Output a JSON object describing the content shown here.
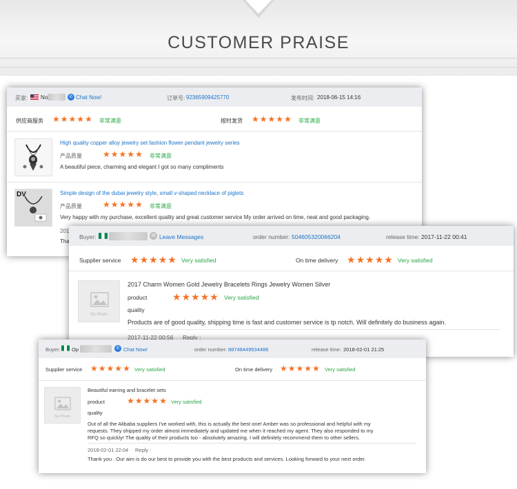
{
  "banner": {
    "title": "CUSTOMER PRAISE"
  },
  "review1": {
    "buyer_label": "买家:",
    "buyer_name": "No",
    "chat": "Chat Now!",
    "order_label": "订单号:",
    "order_number": "92365909425770",
    "time_label": "发布时间:",
    "time": "2018-06-15 14:16",
    "supplier_label": "供应商服务",
    "supplier_rating": "非常满意",
    "delivery_label": "按时发货",
    "delivery_rating": "非常满意",
    "items": [
      {
        "title": "High quality copper alloy jewelry set fashion flower pendant jewelry series",
        "quality_label": "产品质量",
        "rating": "非常满意",
        "comment": "A beautiful piece, charming and elegant I got so many compliments",
        "brand": ""
      },
      {
        "title": "Simple design of the dubai jewelry style, small v-shaped necklace of piglets",
        "quality_label": "产品质量",
        "rating": "非常满意",
        "comment": "Very happy with my purchase, excellent quality and great customer service My order arrived on time, neat and good packaging.",
        "brand": "DV"
      }
    ],
    "peek_date": "201",
    "peek_reply": "Tha"
  },
  "review2": {
    "buyer_label": "Buyer:",
    "leave_messages": "Leave Messages",
    "order_label": "order number:",
    "order_number": "504605320066204",
    "time_label": "release time:",
    "time": "2017-11-22 00:41",
    "supplier_label": "Supplier service",
    "supplier_rating": "Very satisfied",
    "delivery_label": "On time delivery",
    "delivery_rating": "Very satisfied",
    "product_title": "2017 Charm Women Gold Jewelry Bracelets Rings Jewelry Women Silver",
    "product_label": "product",
    "quality_label": "quality",
    "quality_rating": "Very satisfied",
    "comment": "Products are of good quality, shipping time is fast and customer service is tp notch. Will definitely do business again.",
    "reply_date": "2017-11-22 00:56",
    "reply_label": "Reply :",
    "no_photo": "No Photo"
  },
  "review3": {
    "buyer_label": "Buyer:",
    "buyer_name": "Op",
    "chat": "Chat Now!",
    "order_label": "order number:",
    "order_number": "88748449534486",
    "time_label": "release time:",
    "time": "2018-02-01 21:25",
    "supplier_label": "Supplier service",
    "supplier_rating": "Very satisfied",
    "delivery_label": "On time delivery",
    "delivery_rating": "Very satisfied",
    "product_title": "Beautiful earring and bracelet sets",
    "product_label": "product",
    "quality_label": "quality",
    "quality_rating": "Very satisfied",
    "comment_lines": [
      "Out of all the Alibaba suppliers I've worked with, this is actually the best one! Amber was so professional and helpful with my",
      "requests. They shipped my order almost immediately and updated me when it reached my agent. They also responded to my",
      "RFQ so quickly! The quality of their products too - absolutely amazing. I will definitely recommend them to other sellers."
    ],
    "reply_date": "2018-02-01 22:04",
    "reply_label": "Reply :",
    "reply_text": "Thank you . Our aim is do our best to provide you with the best products and services. Looking forward to your next order.",
    "no_photo": "No Photo"
  },
  "colors": {
    "star": "#f57224",
    "link": "#1a73c8",
    "satisfied": "#28a745"
  }
}
